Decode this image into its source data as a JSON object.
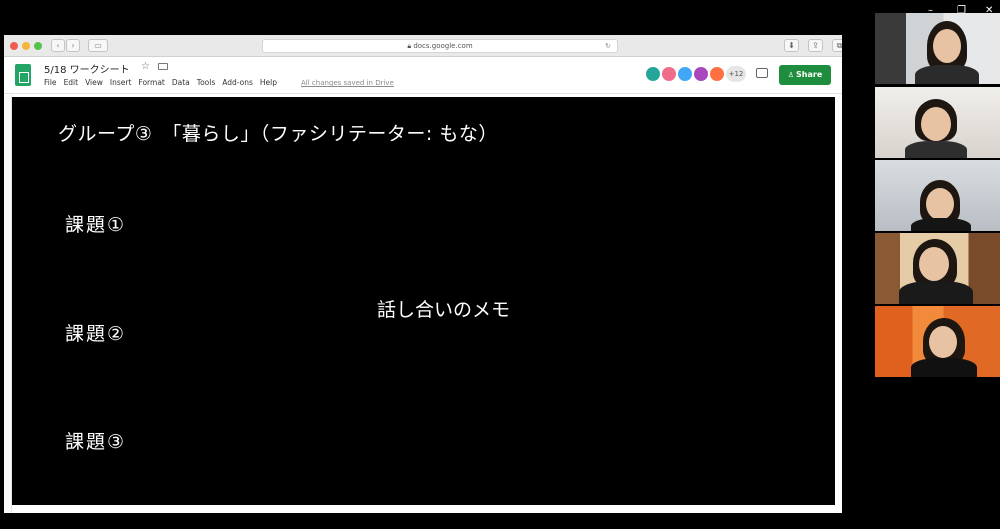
{
  "browser": {
    "url": "docs.google.com"
  },
  "sheets": {
    "doc_title": "5/18 ワークシート",
    "menu": [
      "File",
      "Edit",
      "View",
      "Insert",
      "Format",
      "Data",
      "Tools",
      "Add-ons",
      "Help"
    ],
    "saved_status": "All changes saved in Drive",
    "collaborator_count": "+12",
    "share_label": "Share",
    "avatar_colors": [
      "#26a69a",
      "#ef6c8a",
      "#42a5f5",
      "#ab47bc",
      "#ff7043"
    ],
    "accent_color": "#1e8e3e"
  },
  "slide": {
    "title": "グループ③　「暮らし」（ファシリテーター: もな）",
    "task1": "課題①",
    "task2": "課題②",
    "task3": "課題③",
    "memo": "話し合いのメモ"
  },
  "zoom": {
    "participants": [
      "participant-1",
      "participant-2",
      "participant-3",
      "participant-4",
      "participant-5"
    ]
  }
}
